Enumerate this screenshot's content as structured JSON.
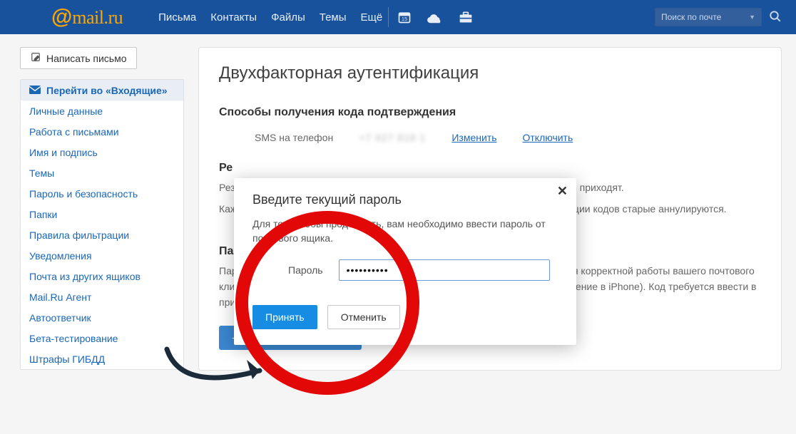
{
  "header": {
    "logo_text": "mail.ru",
    "nav": [
      "Письма",
      "Контакты",
      "Файлы",
      "Темы",
      "Ещё"
    ],
    "search_placeholder": "Поиск по почте"
  },
  "sidebar": {
    "compose": "Написать письмо",
    "items": [
      "Перейти во «Входящие»",
      "Личные данные",
      "Работа с письмами",
      "Имя и подпись",
      "Темы",
      "Пароль и безопасность",
      "Папки",
      "Правила фильтрации",
      "Уведомления",
      "Почта из других ящиков",
      "Mail.Ru Агент",
      "Автоответчик",
      "Бета-тестирование",
      "Штрафы ГИБДД"
    ]
  },
  "main": {
    "title": "Двухфакторная аутентификация",
    "sms_section": "Способы получения кода подтверждения",
    "sms_label": "SMS на телефон",
    "sms_number": "+7 927 818 1",
    "change": "Изменить",
    "disable": "Отключить",
    "rez_heading": "Ре",
    "rez_p1": "Резервные коды позволят вам войти, когда телефон недоступен или SMS не приходят.",
    "rez_p2": "Каждый код можно использовать только один раз. При генерации новой порции кодов старые аннулируются.",
    "apps_heading": "Па",
    "apps_p": "Пароли для внешних приложений — одноразовые пароли, необходимые для корректной работы вашего почтового клиента или стороннего приложения (The Bat!, Outlook или почтовое приложение в iPhone). Код требуется ввести в приложение вместо пароля от почтового ящика при первом входе в Почту.",
    "add_app": "Добавить приложение"
  },
  "modal": {
    "title": "Введите текущий пароль",
    "desc": "Для того чтобы продолжить, вам необходимо ввести пароль от почтового ящика.",
    "password_label": "Пароль",
    "password_value": "••••••••••",
    "accept": "Принять",
    "cancel": "Отменить"
  }
}
